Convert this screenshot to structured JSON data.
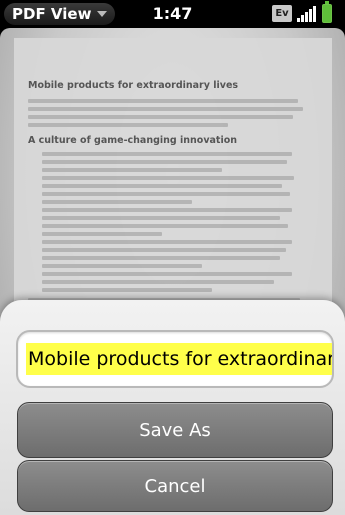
{
  "status_bar": {
    "app_title": "PDF View",
    "time": "1:47",
    "ev_label": "Ev"
  },
  "document": {
    "heading": "Mobile products for extraordinary lives",
    "subheading": "A culture of game-changing innovation"
  },
  "dialog": {
    "filename_value": "Mobile products for extraordinary lives",
    "save_as_label": "Save As",
    "cancel_label": "Cancel"
  }
}
